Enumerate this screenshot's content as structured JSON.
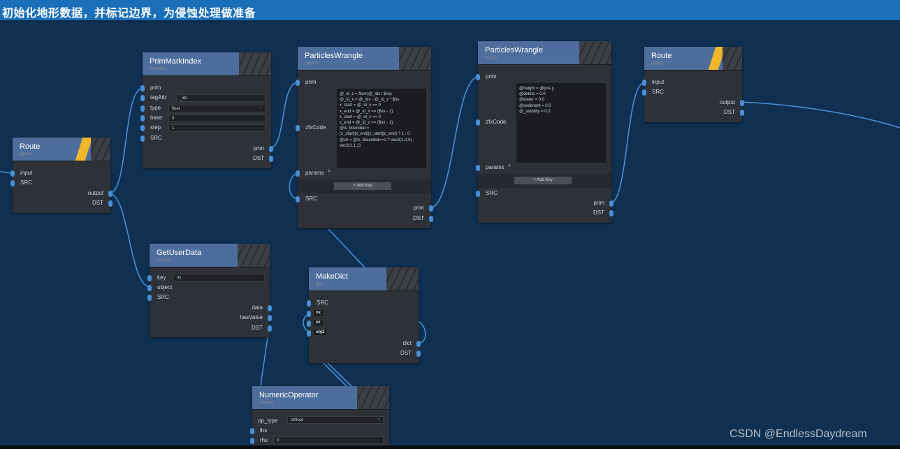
{
  "title": "初始化地形数据，并标记边界，为侵蚀处理做准备",
  "watermark": "CSDN @EndlessDaydream",
  "nodes": {
    "route1": {
      "name": "Route",
      "category": "layout",
      "inputs": [
        "input",
        "SRC"
      ],
      "outputs": [
        "output",
        "DST"
      ]
    },
    "primmark": {
      "name": "PrimMarkIndex",
      "category": "primitive",
      "inputs": [
        "prim",
        "tagAttr",
        "type",
        "base",
        "step",
        "SRC"
      ],
      "values": {
        "tagAttr": "_idx",
        "type": "float",
        "base": "0",
        "step": "1"
      },
      "outputs": [
        "prim",
        "DST"
      ]
    },
    "pw1": {
      "name": "ParticlesWrangle",
      "category": "zenofx",
      "inputs": [
        "prim",
        "zfxCode",
        "params",
        "SRC"
      ],
      "outputs": [
        "prim",
        "DST"
      ],
      "code": "@_id_z = floor(@_idx / $nx)\n@_id_x = @_idx - @_id_z * $nx\nx_start = @_id_x == 0\nx_end = @_id_x == ($nx - 1)\nz_start = @_id_z == 0\nz_end = @_id_z == ($nz - 1)\n@is_bounded = (x_start||x_end||z_start||z_end) ? 1 : 0\n@clr = @is_bounded==1 ? vec3(1,0,0) : vec3(1,1,1)",
      "add_key": "+ Add Key"
    },
    "pw2": {
      "name": "ParticlesWrangle",
      "category": "zenofx",
      "inputs": [
        "prim",
        "zfxCode",
        "params",
        "SRC"
      ],
      "outputs": [
        "prim",
        "DST"
      ],
      "code": "@height = @pos.y\n@debris = 0.0\n@water = 0.0\n@sediment = 0.0\n@_stability = 0.0",
      "add_key": "+ Add Key"
    },
    "route2": {
      "name": "Route",
      "category": "layout",
      "inputs": [
        "input",
        "SRC"
      ],
      "outputs": [
        "output",
        "DST"
      ]
    },
    "getuser": {
      "name": "GetUserData",
      "category": "lifecycle",
      "inputs": [
        "key",
        "object",
        "SRC"
      ],
      "values": {
        "key": "nx"
      },
      "outputs": [
        "data",
        "hasValue",
        "DST"
      ]
    },
    "makedict": {
      "name": "MakeDict",
      "category": "dict",
      "inputs": [
        "SRC"
      ],
      "keys": [
        "nx",
        "nz",
        "obj2"
      ],
      "outputs": [
        "dict",
        "DST"
      ]
    },
    "numop": {
      "name": "NumericOperator",
      "category": "numeric",
      "inputs": [
        "op_type",
        "lhs",
        "rhs"
      ],
      "values": {
        "op_type": "toflloat",
        "rhs": "0"
      }
    }
  },
  "colors": {
    "background": "#0f3050",
    "titlebar": "#1b6fb8",
    "wire": "#4a8fd6",
    "route_accent": "#f0b72a"
  }
}
